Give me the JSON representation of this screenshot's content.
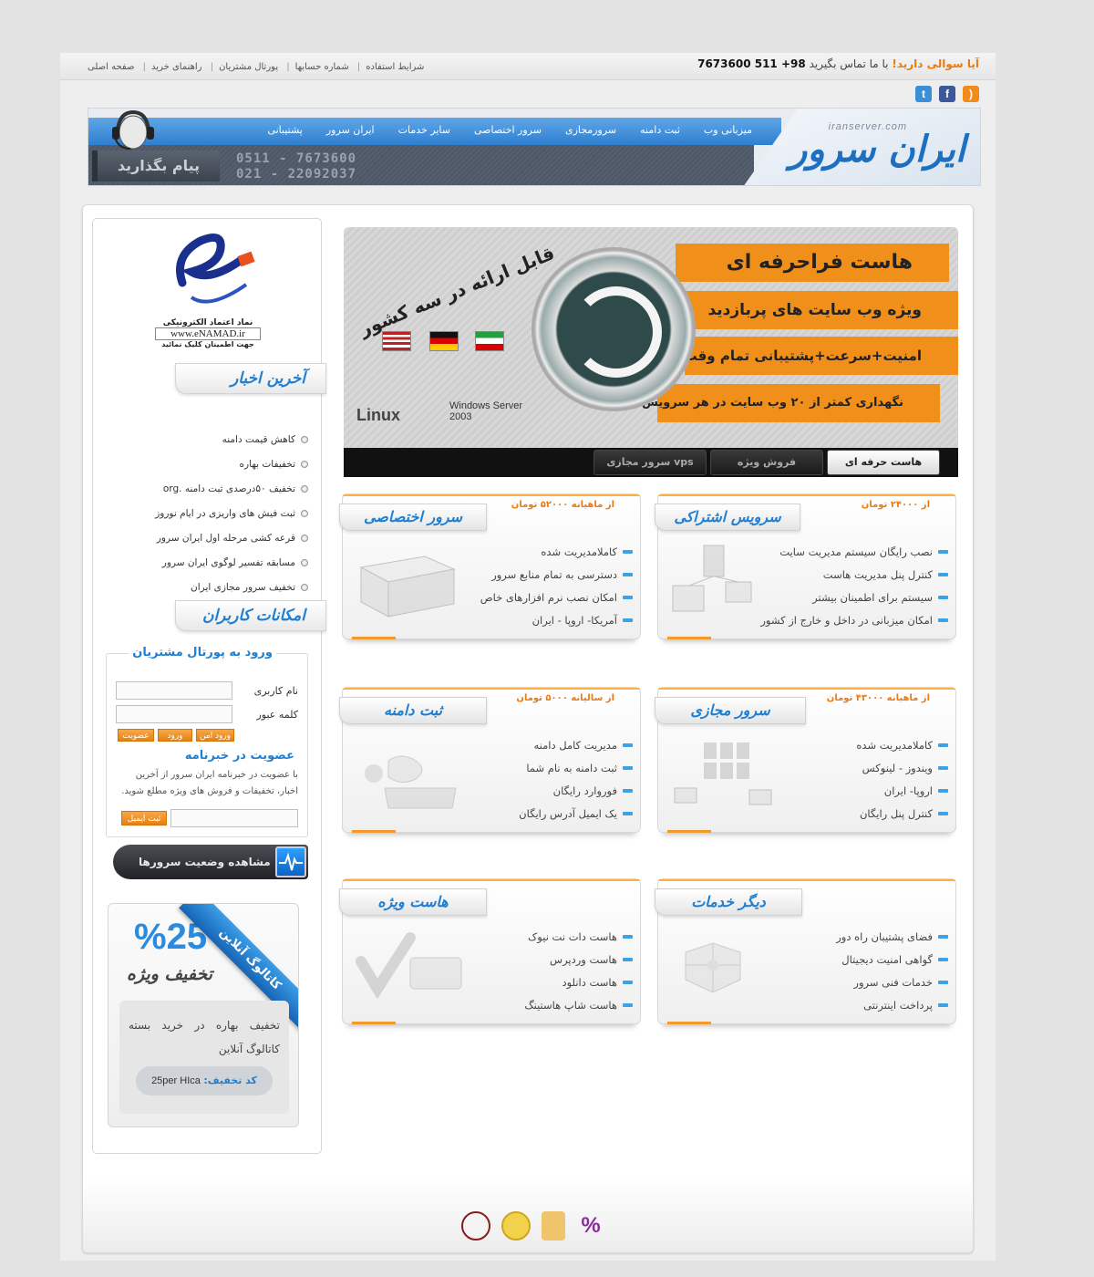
{
  "top": {
    "links": [
      "صفحه اصلی",
      "راهنمای خرید",
      "پورتال مشتریان",
      "شماره حسابها",
      "شرایط استفاده"
    ],
    "contact_question": "آیا سوالی دارید!",
    "contact_text": "با ما تماس بگیرید",
    "contact_phone": "98+ 511 7673600"
  },
  "social": [
    "rss-icon",
    "facebook-icon",
    "twitter-icon"
  ],
  "header": {
    "logo_text": "ایران سرور",
    "logo_domain": "iranserver.com",
    "nav": [
      "میزبانی وب",
      "ثبت دامنه",
      "سرورمجازی",
      "سرور اختصاصی",
      "سایر خدمات",
      "ایران سرور",
      "پشتیبانی"
    ],
    "phones": [
      "0511 - 7673600",
      "021 - 22092037"
    ],
    "leave_message": "پیام بگذارید"
  },
  "sidebar": {
    "enamad_title": "نماد اعتماد الکترونیکی",
    "enamad_url": "www.eNAMAD.ir",
    "enamad_click": "جهت اطمینان کلیک نمائید",
    "news_title": "آخرین اخبار",
    "news": [
      "کاهش قیمت دامنه",
      "تخفیفات بهاره",
      "تخفیف ۵۰درصدی ثبت دامنه .org",
      "ثبت فیش های واریزی در ایام نوروز",
      "قرعه کشی مرحله اول ایران سرور",
      "مسابقه تفسیر لوگوی ایران سرور",
      "تخفیف سرور مجازی ایران"
    ],
    "user_title": "امکانات کاربران",
    "login_legend": "ورود به پورتال مشتریان",
    "username_label": "نام کاربری",
    "password_label": "کلمه عبور",
    "btn_secure_login": "ورود امن",
    "btn_login": "ورود",
    "btn_register": "عضویت",
    "newsletter_title": "عضویت در خبرنامه",
    "newsletter_text": "با عضویت در خبرنامه ایران سرور از آخرین اخبار، تخفیفات و فروش های ویژه مطلع شوید.",
    "newsletter_btn": "ثبت ایمیل",
    "status_btn": "مشاهده وضعیت سرورها",
    "promo_pct": "%25",
    "promo_special": "تخفیف ویژه",
    "promo_ribbon": "کاتالوگ آنلاین",
    "promo_text": "تخفیف بهاره در خرید بسته کاتالوگ آنلاین",
    "promo_code_label": "کد تخفیف:",
    "promo_code": "25per HIca"
  },
  "banner": {
    "line1": "هاست فراحرفه ای",
    "line2": "ویژه وب سایت های پربازدید",
    "line3": "امنیت+سرعت+پشتیبانی تمام وقت",
    "line4": "نگهداری کمتر از ۲۰ وب سایت در هر سرویس",
    "tagline": "قابل ارائه در سه کشور",
    "os1": "Linux",
    "os2": "Windows Server 2003",
    "tabs": [
      "هاست حرفه ای",
      "فروش ویژه",
      "سرور مجازی vps"
    ]
  },
  "cards": [
    {
      "title": "سرویس اشتراکی",
      "price": "از ۲۴۰۰۰ تومان",
      "items": [
        "نصب رایگان سیستم مدیریت سایت",
        "کنترل پنل مدیریت هاست",
        "سیستم برای اطمینان بیشتر",
        "امکان میزبانی در داخل و خارج از کشور"
      ]
    },
    {
      "title": "سرور اختصاصی",
      "price": "از ماهیانه ۵۲۰۰۰ تومان",
      "items": [
        "کاملامدیریت شده",
        "دسترسی به تمام منابع سرور",
        "امکان نصب نرم افزارهای خاص",
        "آمریکا- اروپا - ایران"
      ]
    },
    {
      "title": "سرور مجازی",
      "price": "از ماهیانه ۴۳۰۰۰ تومان",
      "items": [
        "کاملامدیریت شده",
        "ویندوز - لینوکس",
        "اروپا- ایران",
        "کنترل پنل رایگان"
      ]
    },
    {
      "title": "ثبت دامنه",
      "price": "از سالیانه ۵۰۰۰ تومان",
      "items": [
        "مدیریت کامل دامنه",
        "ثبت دامنه به نام شما",
        "فوروارد رایگان",
        "یک ایمیل آدرس رایگان"
      ]
    },
    {
      "title": "دیگر خدمات",
      "price": "",
      "items": [
        "فضای پشتیبان راه دور",
        "گواهی امنیت دیجیتال",
        "خدمات فنی سرور",
        "پرداخت اینترنتی"
      ]
    },
    {
      "title": "هاست ویژه",
      "price": "",
      "items": [
        "هاست دات نت نیوک",
        "هاست وردپرس",
        "هاست دانلود",
        "هاست شاپ هاستینگ"
      ]
    }
  ],
  "colors": {
    "accent_blue": "#1f7fd1",
    "accent_orange": "#ee7a0e",
    "banner_orange": "#f08f1a"
  }
}
